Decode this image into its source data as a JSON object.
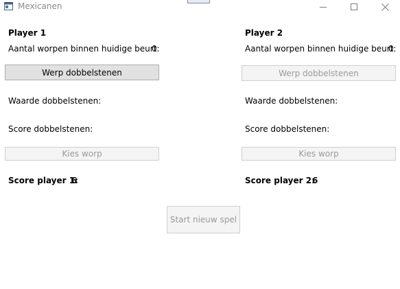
{
  "window": {
    "title": "Mexicanen",
    "controls": {
      "minimize": "minimize-icon",
      "maximize": "maximize-icon",
      "close": "close-icon"
    }
  },
  "player1": {
    "heading": "Player 1",
    "throws_label": "Aantal worpen binnen huidige beurt:",
    "throws_value": "0",
    "throw_button": "Werp dobbelstenen",
    "dice_value_label": "Waarde dobbelstenen:",
    "dice_score_label": "Score dobbelstenen:",
    "choose_button": "Kies worp",
    "score_label": "Score player 1:",
    "score_value": "6"
  },
  "player2": {
    "heading": "Player 2",
    "throws_label": "Aantal worpen binnen huidige beurt:",
    "throws_value": "0",
    "throw_button": "Werp dobbelstenen",
    "dice_value_label": "Waarde dobbelstenen:",
    "dice_score_label": "Score dobbelstenen:",
    "choose_button": "Kies worp",
    "score_label": "Score player 2:",
    "score_value": "6"
  },
  "new_game_button": "Start nieuw spel",
  "colors": {
    "enabled_button_bg": "#e1e1e1",
    "disabled_button_bg": "#f4f4f4",
    "disabled_text": "#9a9a9a"
  }
}
